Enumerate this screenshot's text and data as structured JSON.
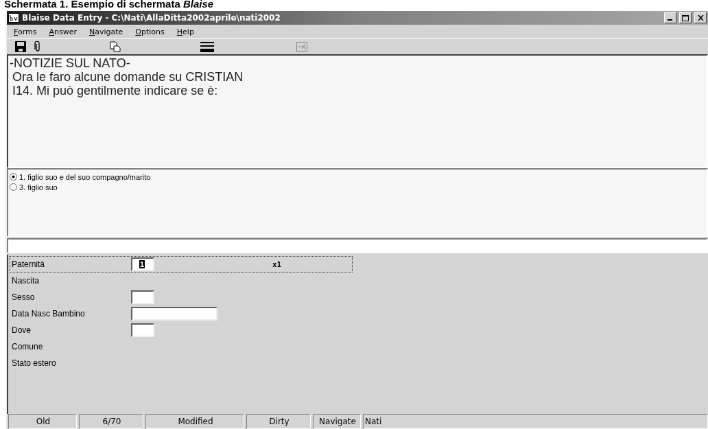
{
  "caption": {
    "prefix": "Schermata 1. Esempio di schermata ",
    "emphasis": "Blaise"
  },
  "window": {
    "title": "Blaise Data Entry - C:\\Nati\\AllaDitta2002aprile\\nati2002"
  },
  "menu": [
    {
      "label": "Forms"
    },
    {
      "label": "Answer"
    },
    {
      "label": "Navigate"
    },
    {
      "label": "Options"
    },
    {
      "label": "Help"
    }
  ],
  "question": {
    "lines": [
      "-NOTIZIE SUL NATO-",
      "Ora le faro alcune domande su CRISTIAN",
      "I14. Mi può gentilmente indicare se è:"
    ]
  },
  "answers": [
    {
      "label": "1.  figlio suo e del suo compagno/marito",
      "selected": true
    },
    {
      "label": "3.  figlio suo",
      "selected": false
    }
  ],
  "form": [
    {
      "label": "Paternità",
      "kind": "short-field",
      "value": "1",
      "note": "x1",
      "selected": true
    },
    {
      "label": "Nascita",
      "kind": "label",
      "selected": false
    },
    {
      "label": "Sesso",
      "kind": "short-field",
      "selected": false
    },
    {
      "label": "Data Nasc Bambino",
      "kind": "long-field",
      "selected": false
    },
    {
      "label": "Dove",
      "kind": "short-field",
      "selected": false
    },
    {
      "label": "Comune",
      "kind": "label",
      "selected": false
    },
    {
      "label": "Stato estero",
      "kind": "label",
      "selected": false
    }
  ],
  "status_bar": [
    "Old",
    "6/70",
    "Modified",
    "Dirty",
    "Navigate",
    "Nati"
  ]
}
